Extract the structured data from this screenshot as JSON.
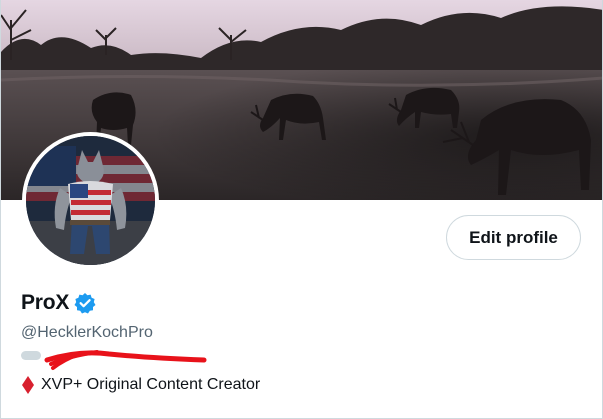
{
  "profile": {
    "display_name": "ProX",
    "handle": "@HecklerKochPro",
    "bio": "XVP+ Original Content Creator",
    "verified": true
  },
  "actions": {
    "edit_profile_label": "Edit profile"
  },
  "icons": {
    "verified": "verified-badge-icon",
    "bio_emoji": "red-diamond-icon"
  },
  "colors": {
    "verified_blue": "#1d9bf0",
    "text_primary": "#0f1419",
    "text_secondary": "#536471",
    "border": "#cfd9de",
    "annotation_red": "#e8121a",
    "diamond_red": "#d8202e"
  }
}
